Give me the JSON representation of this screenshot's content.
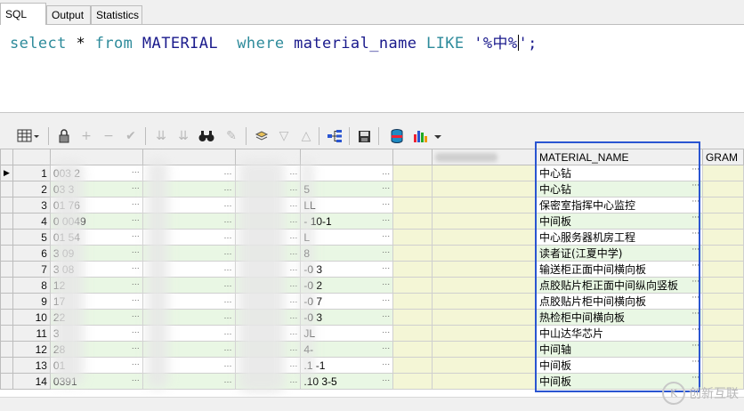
{
  "tabs": [
    {
      "label": "SQL",
      "active": true
    },
    {
      "label": "Output",
      "active": false
    },
    {
      "label": "Statistics",
      "active": false
    }
  ],
  "editor": {
    "kw_select": "select",
    "op_star": "*",
    "kw_from": "from",
    "table": "MATERIAL",
    "kw_where": "where",
    "column": "material_name",
    "kw_like": "LIKE",
    "string": "'%中%",
    "string_end": "';"
  },
  "grid": {
    "headers": {
      "blurred_header": "E_CODE",
      "material_name": "MATERIAL_NAME",
      "gram": "GRAM"
    },
    "rows": [
      {
        "no": "1",
        "c1": "003  2",
        "c3": "",
        "name": "中心钻"
      },
      {
        "no": "2",
        "c1": "03   3",
        "c3": "5",
        "name": "中心钻"
      },
      {
        "no": "3",
        "c1": "01  76",
        "c3": "LL",
        "name": "保密室指挥中心监控"
      },
      {
        "no": "4",
        "c1": "0  0049",
        "c3": "-   10-1",
        "name": "中间板"
      },
      {
        "no": "5",
        "c1": "01  54",
        "c3": "L",
        "name": "中心服务器机房工程"
      },
      {
        "no": "6",
        "c1": "3   09",
        "c3": "8",
        "name": "读者证(江夏中学)"
      },
      {
        "no": "7",
        "c1": "3   08",
        "c3": "-0  3",
        "name": "输送柜正面中间横向板"
      },
      {
        "no": "8",
        "c1": "    12",
        "c3": "-0  2",
        "name": "点胶贴片柜正面中间纵向竖板"
      },
      {
        "no": "9",
        "c1": "    17",
        "c3": "-0  7",
        "name": "点胶贴片柜中间横向板"
      },
      {
        "no": "10",
        "c1": "    22",
        "c3": "-0  3",
        "name": "热检柜中间横向板"
      },
      {
        "no": "11",
        "c1": "    3",
        "c3": "JL",
        "name": "中山达华芯片"
      },
      {
        "no": "12",
        "c1": "    28",
        "c3": "4-",
        "name": "中间轴"
      },
      {
        "no": "13",
        "c1": "    01",
        "c3": ".1  -1",
        "name": "中间板"
      },
      {
        "no": "14",
        "c1": "  0391",
        "c3": ".10  3-5",
        "name": "中间板"
      }
    ]
  },
  "watermark": {
    "logo": "K",
    "text": "创新互联"
  },
  "colors": {
    "highlight": "#2a55d1",
    "row_even": "#e9f7e4",
    "keyword": "#2e8b9b",
    "identifier": "#1a1a8c"
  },
  "icons": [
    "grid-icon",
    "lock-icon",
    "plus-icon",
    "minus-icon",
    "check-icon",
    "double-down-icon",
    "double-down-alt-icon",
    "binoculars-icon",
    "eraser-icon",
    "refresh-icon",
    "triangle-down-icon",
    "triangle-up-icon",
    "tree-icon",
    "save-icon",
    "database-icon",
    "chart-icon"
  ]
}
